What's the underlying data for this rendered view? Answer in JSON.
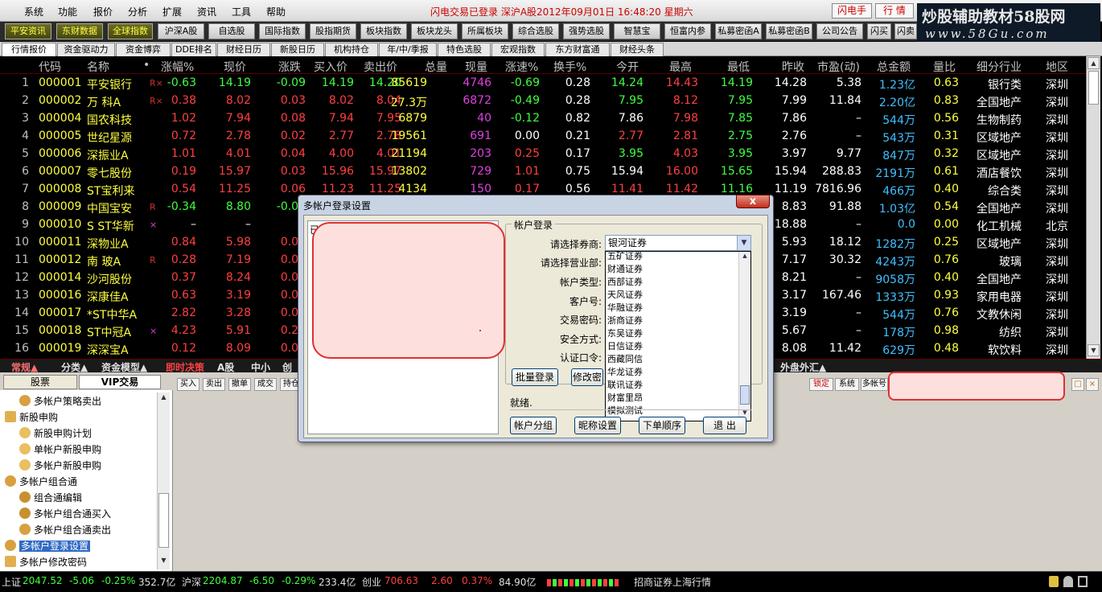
{
  "menubar": {
    "items": [
      "系统",
      "功能",
      "报价",
      "分析",
      "扩展",
      "资讯",
      "工具",
      "帮助"
    ],
    "status": "闪电交易已登录   深沪A股2012年09月01日  16:48:20 星期六",
    "btn1": "闪电手",
    "btn2": "行 情"
  },
  "watermark": {
    "line1": "炒股辅助教材58股网",
    "line2": "www.58Gu.com"
  },
  "toolbar": [
    "平安资讯",
    "东财数据",
    "全球指数",
    "沪深A股",
    "自选股",
    "国际指数",
    "股指期货",
    "板块指数",
    "板块龙头",
    "所属板块",
    "综合选股",
    "强势选股",
    "智慧宝",
    "恒富内参",
    "私募密函A",
    "私募密函B",
    "公司公告",
    "闪买",
    "闪卖"
  ],
  "tabs": [
    "行情报价",
    "资金驱动力",
    "资金博弈",
    "DDE排名",
    "财经日历",
    "新股日历",
    "机构持仓",
    "年/中/季报",
    "特色选股",
    "宏观指数",
    "东方财富通",
    "财经头条"
  ],
  "columns": [
    "代码",
    "名称",
    "•",
    "涨幅%",
    "现价",
    "涨跌",
    "买入价",
    "卖出价",
    "总量",
    "现量",
    "涨速%",
    "换手%",
    "今开",
    "最高",
    "最低",
    "昨收",
    "市盈(动)",
    "总金额",
    "量比",
    "细分行业",
    "地区"
  ],
  "rows": [
    [
      "1",
      "000001",
      "平安银行",
      "R×",
      "-0.63",
      "14.19",
      "-0.09",
      "14.19",
      "14.20",
      "85619",
      "4746",
      "-0.69",
      "0.28",
      "14.24",
      "14.43",
      "14.19",
      "14.28",
      "5.38",
      "1.23亿",
      "0.63",
      "银行类",
      "深圳"
    ],
    [
      "2",
      "000002",
      "万  科A",
      "R×",
      "0.38",
      "8.02",
      "0.03",
      "8.02",
      "8.04",
      "27.3万",
      "6872",
      "-0.49",
      "0.28",
      "7.95",
      "8.12",
      "7.95",
      "7.99",
      "11.84",
      "2.20亿",
      "0.83",
      "全国地产",
      "深圳"
    ],
    [
      "3",
      "000004",
      "国农科技",
      "",
      "1.02",
      "7.94",
      "0.08",
      "7.94",
      "7.95",
      "6879",
      "40",
      "-0.12",
      "0.82",
      "7.86",
      "7.98",
      "7.85",
      "7.86",
      "–",
      "544万",
      "0.56",
      "生物制药",
      "深圳"
    ],
    [
      "4",
      "000005",
      "世纪星源",
      "",
      "0.72",
      "2.78",
      "0.02",
      "2.77",
      "2.78",
      "19561",
      "691",
      "0.00",
      "0.21",
      "2.77",
      "2.81",
      "2.75",
      "2.76",
      "–",
      "543万",
      "0.31",
      "区域地产",
      "深圳"
    ],
    [
      "5",
      "000006",
      "深振业A",
      "",
      "1.01",
      "4.01",
      "0.04",
      "4.00",
      "4.01",
      "21194",
      "203",
      "0.25",
      "0.17",
      "3.95",
      "4.03",
      "3.95",
      "3.97",
      "9.77",
      "847万",
      "0.32",
      "区域地产",
      "深圳"
    ],
    [
      "6",
      "000007",
      "零七股份",
      "",
      "0.19",
      "15.97",
      "0.03",
      "15.96",
      "15.97",
      "13802",
      "729",
      "1.01",
      "0.75",
      "15.94",
      "16.00",
      "15.65",
      "15.94",
      "288.83",
      "2191万",
      "0.61",
      "酒店餐饮",
      "深圳"
    ],
    [
      "7",
      "000008",
      "ST宝利来",
      "",
      "0.54",
      "11.25",
      "0.06",
      "11.23",
      "11.25",
      "4134",
      "150",
      "0.17",
      "0.56",
      "11.41",
      "11.42",
      "11.16",
      "11.19",
      "7816.96",
      "466万",
      "0.40",
      "综合类",
      "深圳"
    ],
    [
      "8",
      "000009",
      "中国宝安",
      "R",
      "-0.34",
      "8.80",
      "-0.03",
      "",
      "",
      "",
      "",
      "",
      "",
      "",
      "",
      "",
      "8.83",
      "91.88",
      "1.03亿",
      "0.54",
      "全国地产",
      "深圳"
    ],
    [
      "9",
      "000010",
      "S ST华新",
      "×",
      "–",
      "–",
      "–",
      "",
      "",
      "",
      "",
      "",
      "",
      "",
      "",
      "",
      "18.88",
      "–",
      "0.0",
      "0.00",
      "化工机械",
      "北京"
    ],
    [
      "10",
      "000011",
      "深物业A",
      "",
      "0.84",
      "5.98",
      "0.05",
      "",
      "",
      "",
      "",
      "",
      "",
      "",
      "",
      "",
      "5.93",
      "18.12",
      "1282万",
      "0.25",
      "区域地产",
      "深圳"
    ],
    [
      "11",
      "000012",
      "南  玻A",
      "R",
      "0.28",
      "7.19",
      "0.02",
      "",
      "",
      "",
      "",
      "",
      "",
      "",
      "",
      "",
      "7.17",
      "30.32",
      "4243万",
      "0.76",
      "玻璃",
      "深圳"
    ],
    [
      "12",
      "000014",
      "沙河股份",
      "",
      "0.37",
      "8.24",
      "0.03",
      "",
      "",
      "",
      "",
      "",
      "",
      "",
      "",
      "",
      "8.21",
      "–",
      "9058万",
      "0.40",
      "全国地产",
      "深圳"
    ],
    [
      "13",
      "000016",
      "深康佳A",
      "",
      "0.63",
      "3.19",
      "0.02",
      "",
      "",
      "",
      "",
      "",
      "",
      "",
      "",
      "",
      "3.17",
      "167.46",
      "1333万",
      "0.93",
      "家用电器",
      "深圳"
    ],
    [
      "14",
      "000017",
      "*ST中华A",
      "",
      "2.82",
      "3.28",
      "0.09",
      "",
      "",
      "",
      "",
      "",
      "",
      "",
      "",
      "",
      "3.19",
      "–",
      "544万",
      "0.76",
      "文教休闲",
      "深圳"
    ],
    [
      "15",
      "000018",
      "ST中冠A",
      "×",
      "4.23",
      "5.91",
      "0.24",
      "",
      "",
      "",
      "",
      "",
      "",
      "",
      "",
      "",
      "5.67",
      "–",
      "178万",
      "0.98",
      "纺织",
      "深圳"
    ],
    [
      "16",
      "000019",
      "深深宝A",
      "",
      "0.12",
      "8.09",
      "0.01",
      "",
      "",
      "",
      "",
      "",
      "",
      "",
      "",
      "",
      "8.08",
      "11.42",
      "629万",
      "0.48",
      "软饮料",
      "深圳"
    ]
  ],
  "bottomtabs": [
    "常规▲",
    "分类▲",
    "资金模型▲",
    "即时决策",
    "A股",
    "中小",
    "创",
    "外盘外汇▲"
  ],
  "leftpanel": {
    "tab1": "股票",
    "tab2": "VIP交易",
    "tree": [
      "多帐户策略卖出",
      "新股申购",
      "新股申购计划",
      "单帐户新股申购",
      "多帐户新股申购",
      "多帐户组合通",
      "组合通编辑",
      "多帐户组合通买入",
      "多帐户组合通卖出",
      "多帐户登录设置",
      "多帐户修改密码"
    ]
  },
  "opbar": [
    "买入",
    "卖出",
    "撤单",
    "成交",
    "持仓"
  ],
  "opbar_right": [
    "锁定",
    "系统",
    "多帐号"
  ],
  "dialog": {
    "title": "多帐户登录设置",
    "close": "x",
    "list_label": "已",
    "legend": "帐户登录",
    "labels": [
      "请选择券商:",
      "请选择营业部:",
      "帐户类型:",
      "客户号:",
      "交易密码:",
      "安全方式:",
      "认证口令:"
    ],
    "broker": "银河证券",
    "options": [
      "五矿证券",
      "财通证券",
      "西部证券",
      "天风证券",
      "华融证券",
      "浙商证券",
      "东吴证券",
      "日信证券",
      "西藏同信",
      "华龙证券",
      "联讯证券",
      "财富里昂",
      "模拟测试"
    ],
    "batch_login": "批量登录",
    "modify": "修改密",
    "ready": "就绪.",
    "buttons": [
      "帐户分组",
      "昵称设置",
      "下单顺序",
      "退 出"
    ]
  },
  "statusbar": {
    "sh_label": "上证",
    "sh_val": "2047.52",
    "sh_chg": "-5.06",
    "sh_pct": "-0.25%",
    "sh_amt": "352.7亿",
    "hs_label": "沪深",
    "hs_val": "2204.87",
    "hs_chg": "-6.50",
    "hs_pct": "-0.29%",
    "hs_amt": "233.4亿",
    "cy_label": "创业",
    "cy_val": "706.63",
    "cy_chg": "2.60",
    "cy_pct": "0.37%",
    "cy_amt": "84.90亿",
    "broker_info": "招商证券上海行情"
  },
  "colors": {
    "up": "#ff4040",
    "down": "#40ff40",
    "code": "#ffff40",
    "volume": "#ffff40",
    "amount": "#40c0ff",
    "flat": "#ffffff",
    "magenta": "#e040e0"
  }
}
